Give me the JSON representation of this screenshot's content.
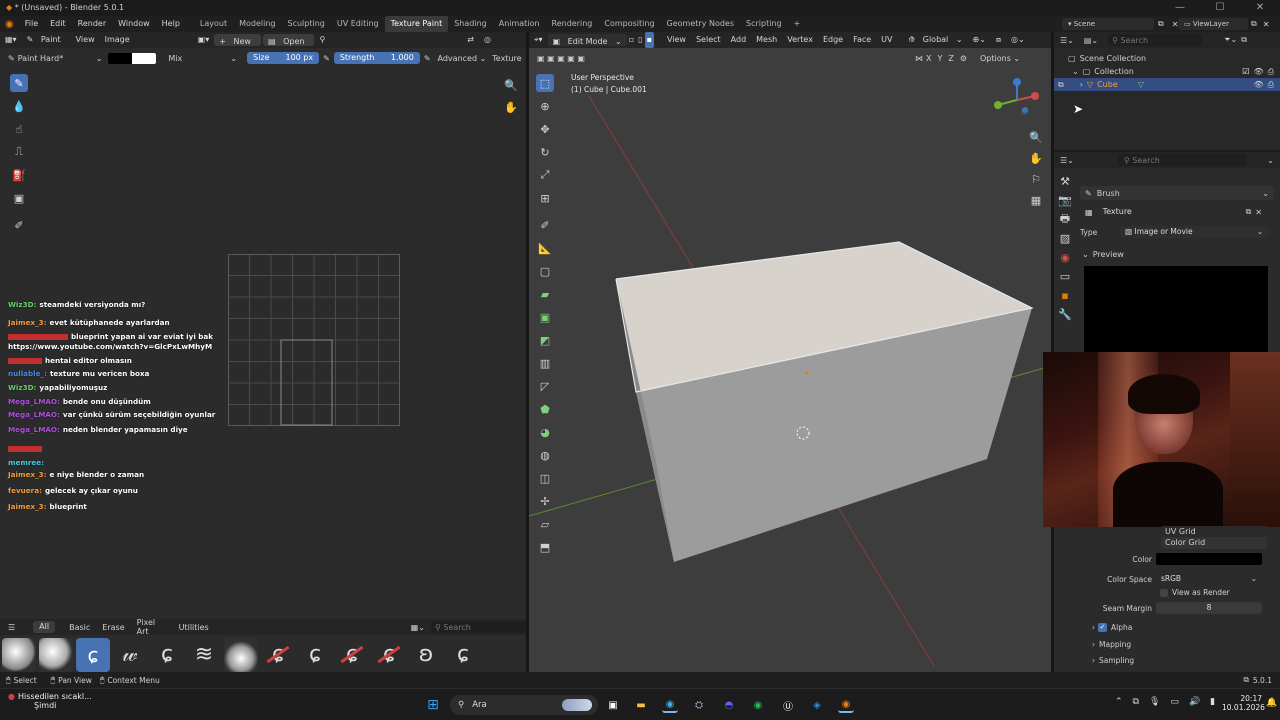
{
  "window": {
    "title": "* (Unsaved) - Blender 5.0.1"
  },
  "menus": [
    "File",
    "Edit",
    "Render",
    "Window",
    "Help"
  ],
  "workspaces": [
    "Layout",
    "Modeling",
    "Sculpting",
    "UV Editing",
    "Texture Paint",
    "Shading",
    "Animation",
    "Rendering",
    "Compositing",
    "Geometry Nodes",
    "Scripting"
  ],
  "active_workspace": "Texture Paint",
  "scene": {
    "scene_label": "Scene",
    "viewlayer_label": "ViewLayer"
  },
  "image_editor": {
    "header": {
      "mode": "Paint",
      "view": "View",
      "image": "Image",
      "new": "New",
      "open": "Open"
    },
    "toolbar": {
      "brush": "Paint Hard*",
      "blend": "Mix",
      "size_label": "Size",
      "size_value": "100 px",
      "strength_label": "Strength",
      "strength_value": "1.000",
      "advanced": "Advanced",
      "texture": "Texture"
    }
  },
  "chat": [
    {
      "user": "Wiz3D:",
      "msg": "steamdeki versiyonda mı?",
      "color": "#6ad06a"
    },
    {
      "user": "Jaimex_3:",
      "msg": "evet kütüphanede ayarlardan",
      "color": "#f0a040"
    },
    {
      "user": "",
      "msg": "blueprint yapan ai var eviat iyi bak",
      "color": "#e04040"
    },
    {
      "user": "",
      "msg": "https://www.youtube.com/watch?v=GlcPxLwMhyM",
      "color": "#ffffff"
    },
    {
      "user": "",
      "msg": "hentai editor olmasın",
      "color": "#e04040"
    },
    {
      "user": "nullable_:",
      "msg": "texture mu vericen boxa",
      "color": "#4a8ae8"
    },
    {
      "user": "Wiz3D:",
      "msg": "yapabiliyomuşuz",
      "color": "#6ad06a"
    },
    {
      "user": "Mega_LMAO:",
      "msg": "bende onu düşündüm",
      "color": "#b050e0"
    },
    {
      "user": "Mega_LMAO:",
      "msg": "var çünkü sürüm seçebildiğin oyunlar",
      "color": "#b050e0"
    },
    {
      "user": "Mega_LMAO:",
      "msg": "neden blender yapamasın diye",
      "color": "#b050e0"
    },
    {
      "user": "",
      "msg": "",
      "color": "#e04040"
    },
    {
      "user": "memree:",
      "msg": "",
      "color": "#40d0e0"
    },
    {
      "user": "Jaimex_3:",
      "msg": "e niye blender o zaman",
      "color": "#f0a040"
    },
    {
      "user": "fevuera:",
      "msg": "gelecek ay çıkar oyunu",
      "color": "#f0a040"
    },
    {
      "user": "Jaimex_3:",
      "msg": "blueprint",
      "color": "#f0a040"
    }
  ],
  "brush_shelf": {
    "tabs": [
      "All",
      "Basic",
      "Erase",
      "Pixel Art",
      "Utilities"
    ],
    "active_tab": "All",
    "search_placeholder": "Search"
  },
  "viewport": {
    "header": {
      "mode": "Edit Mode",
      "menus": [
        "View",
        "Select",
        "Add",
        "Mesh",
        "Vertex",
        "Edge",
        "Face",
        "UV"
      ],
      "orientation": "Global",
      "options": "Options"
    },
    "overlay_text": {
      "line1": "User Perspective",
      "line2": "(1) Cube | Cube.001"
    },
    "axes": {
      "x": "X",
      "y": "Y",
      "z": "Z"
    }
  },
  "outliner": {
    "search_placeholder": "Search",
    "items": [
      {
        "label": "Scene Collection",
        "depth": 0
      },
      {
        "label": "Collection",
        "depth": 1
      },
      {
        "label": "Cube",
        "depth": 2
      }
    ]
  },
  "properties": {
    "search_placeholder": "Search",
    "brush_label": "Brush",
    "texture_label": "Texture",
    "type_label": "Type",
    "type_value": "Image or Movie",
    "preview_label": "Preview",
    "generated_options": [
      "UV Grid",
      "Color Grid"
    ],
    "color_label": "Color",
    "color_space_label": "Color Space",
    "color_space_value": "sRGB",
    "view_as_render": "View as Render",
    "seam_margin_label": "Seam Margin",
    "seam_margin_value": "8",
    "alpha_label": "Alpha",
    "mapping_label": "Mapping",
    "sampling_label": "Sampling"
  },
  "statusbar": {
    "select": "Select",
    "pan": "Pan View",
    "context": "Context Menu",
    "version": "5.0.1"
  },
  "taskbar": {
    "weather": "Hissedilen sıcakl...",
    "weather_sub": "Şimdi",
    "search": "Ara",
    "time": "20:17",
    "date": "10.01.2026"
  },
  "colors": {
    "accent": "#4772b3",
    "header": "#252525",
    "panel": "#303030"
  }
}
